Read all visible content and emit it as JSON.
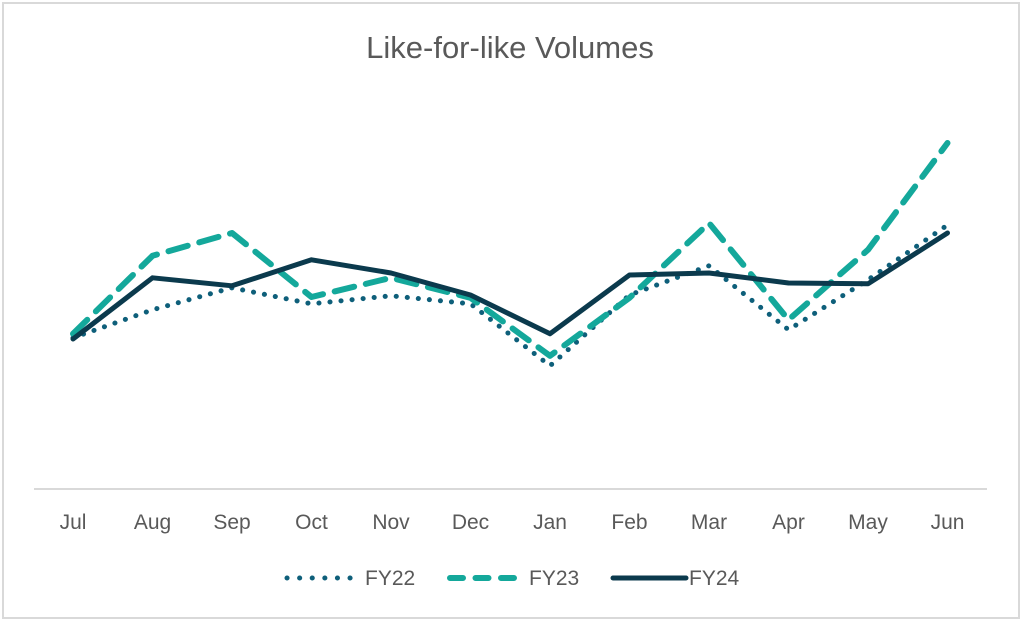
{
  "chart_data": {
    "type": "line",
    "title": "Like-for-like Volumes",
    "xlabel": "",
    "ylabel": "",
    "y_axis_labels_shown": false,
    "ylim": [
      0,
      100
    ],
    "y_scale_note": "relative index (no y-axis values shown)",
    "grid": false,
    "legend_position": "bottom",
    "categories": [
      "Jul",
      "Aug",
      "Sep",
      "Oct",
      "Nov",
      "Dec",
      "Jan",
      "Feb",
      "Mar",
      "Apr",
      "May",
      "Jun"
    ],
    "series": [
      {
        "name": "FY22",
        "style": "dotted",
        "color": "#0e5f7a",
        "values": [
          37.8,
          44.8,
          50.3,
          46.3,
          48.3,
          46.3,
          30.8,
          48.5,
          55.8,
          39.8,
          52.3,
          66.0
        ]
      },
      {
        "name": "FY23",
        "style": "dashed",
        "color": "#14a89b",
        "values": [
          38.8,
          58.3,
          64.0,
          48.0,
          52.8,
          47.8,
          33.3,
          47.8,
          66.5,
          42.3,
          59.8,
          86.5
        ]
      },
      {
        "name": "FY24",
        "style": "solid",
        "color": "#0b3a4d",
        "values": [
          37.5,
          52.8,
          50.8,
          57.3,
          54.0,
          48.5,
          38.8,
          53.5,
          54.0,
          51.5,
          51.3,
          64.0
        ]
      }
    ]
  }
}
